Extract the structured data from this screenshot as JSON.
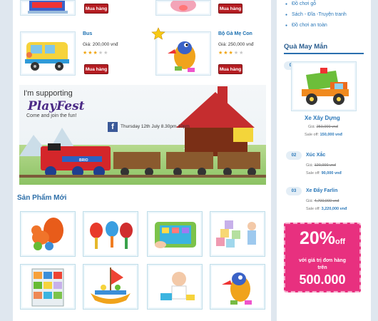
{
  "colors": {
    "accent": "#2b78b9",
    "buy": "#b51d22",
    "promo": "#e8307f",
    "price": "#2b78b9"
  },
  "top_products": [
    {
      "buy_label": "Mua hàng"
    },
    {
      "buy_label": "Mua hàng"
    }
  ],
  "products": [
    {
      "name": "Bus",
      "price": "Giá: 200,000 vnđ",
      "rating": 3,
      "buy_label": "Mua hàng",
      "icon": "toy-bus"
    },
    {
      "name": "Bộ Gà Mẹ Con",
      "price": "Giá: 250,000 vnđ",
      "rating": 3,
      "buy_label": "Mua hàng",
      "icon": "toy-chicken"
    }
  ],
  "banner": {
    "line1": "I'm supporting",
    "brand": "PlayFest",
    "line2": "Come and join the fun!",
    "date": "Thursday 12th July 8.30pm-10pm",
    "train_text": "BRIO",
    "fb_icon": "facebook-icon"
  },
  "new_products": {
    "title": "Sản Phẩm Mới",
    "items": [
      {
        "icon": "squirrel-toy"
      },
      {
        "icon": "maracas-toy"
      },
      {
        "icon": "tablet-toy"
      },
      {
        "icon": "blocks-toy"
      },
      {
        "icon": "shelf-toy"
      },
      {
        "icon": "boat-toy"
      },
      {
        "icon": "baby-toy"
      },
      {
        "icon": "bird-toy"
      }
    ]
  },
  "sidebar": {
    "links": [
      "Đồ chơi gỗ",
      "Sách - Đĩa -Truyện tranh",
      "Đồ chơi an toàn"
    ],
    "gift_heading": "Quà May Mắn",
    "gifts": [
      {
        "num": "01",
        "name": "Xe Xây Dựng",
        "old_label": "Giá:",
        "old_price": "250,000 vnđ",
        "sale_label": "Sale off:",
        "sale_price": "150,000 vnđ"
      },
      {
        "num": "02",
        "name": "Xúc Xắc",
        "old_label": "Giá:",
        "old_price": "120,000 vnđ",
        "sale_label": "Sale off:",
        "sale_price": "90,000 vnđ"
      },
      {
        "num": "03",
        "name": "Xe Đẩy Farlin",
        "old_label": "Giá:",
        "old_price": "4,700,000 vnđ",
        "sale_label": "Sale off:",
        "sale_price": "3,220,000 vnđ"
      }
    ],
    "promo": {
      "percent": "20%",
      "off": "off",
      "line1": "với giá trị đơn hàng",
      "line2": "trên",
      "amount": "500.000"
    }
  }
}
